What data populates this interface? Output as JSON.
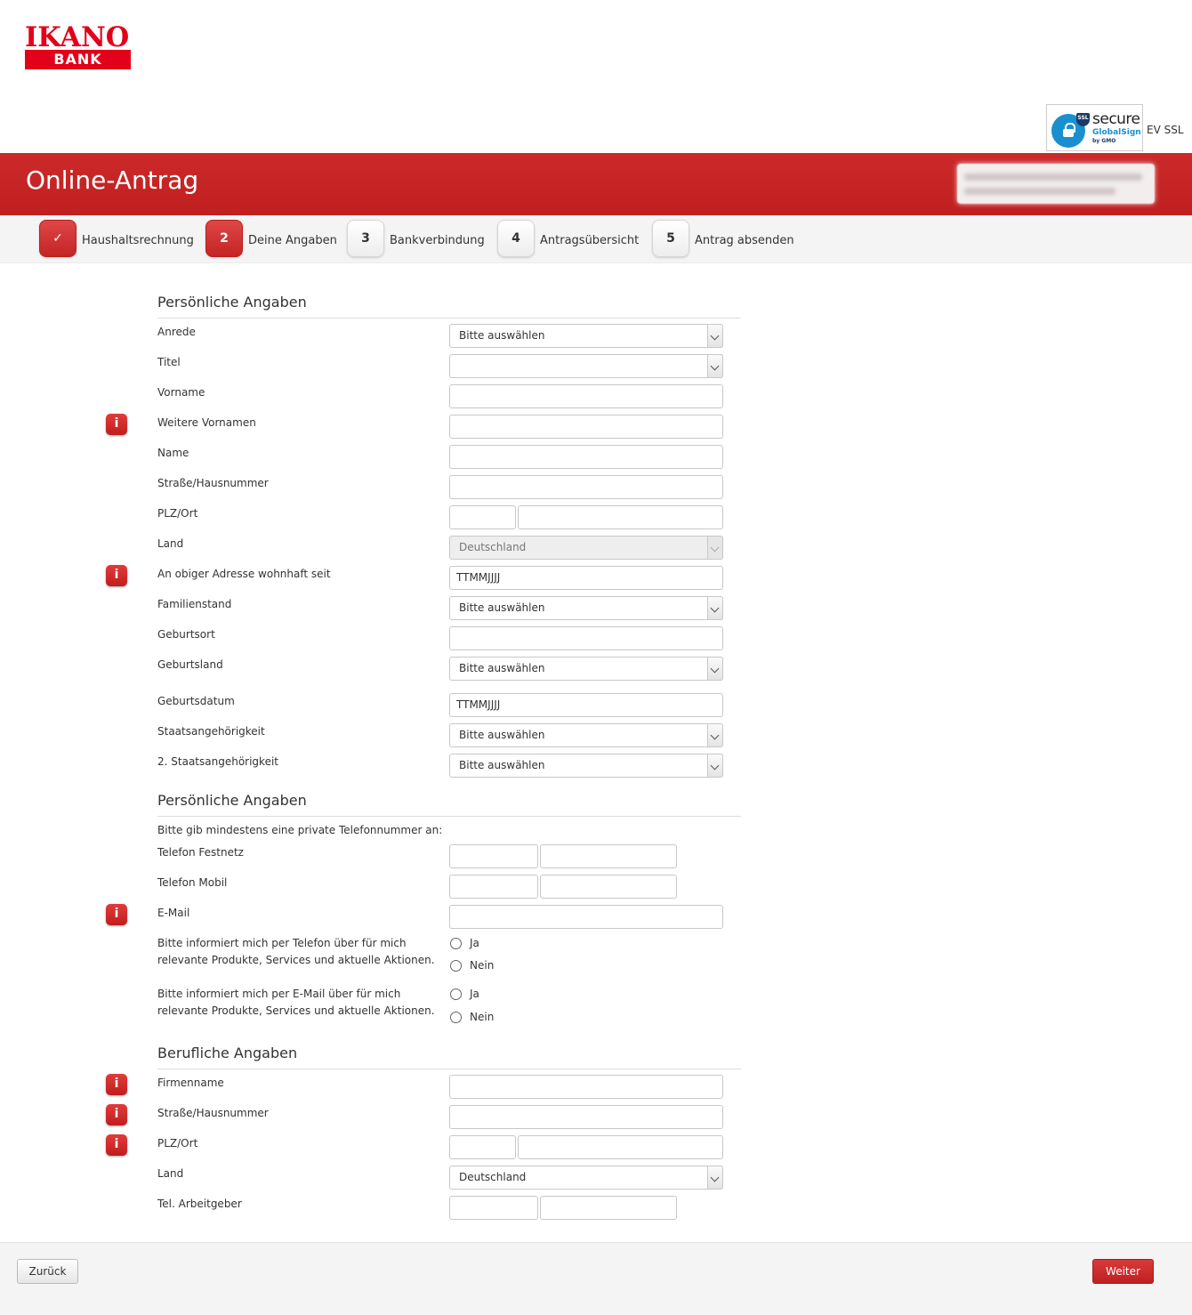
{
  "brand": {
    "logo_top": "IKANO",
    "logo_bottom": "BANK"
  },
  "ssl": {
    "badge": "SSL",
    "secure": "secure",
    "globalsign": "GlobalSign",
    "gmo": "by GMO",
    "ev": "EV SSL"
  },
  "header": {
    "title": "Online-Antrag"
  },
  "steps": [
    {
      "num": "✓",
      "label": "Haushaltsrechnung"
    },
    {
      "num": "2",
      "label": "Deine Angaben"
    },
    {
      "num": "3",
      "label": "Bankverbindung"
    },
    {
      "num": "4",
      "label": "Antragsübersicht"
    },
    {
      "num": "5",
      "label": "Antrag absenden"
    }
  ],
  "personal": {
    "title": "Persönliche Angaben",
    "anrede": {
      "label": "Anrede",
      "value": "Bitte auswählen"
    },
    "titel": {
      "label": "Titel",
      "value": ""
    },
    "vorname": {
      "label": "Vorname"
    },
    "weitere_vornamen": {
      "label": "Weitere Vornamen"
    },
    "name": {
      "label": "Name"
    },
    "strasse": {
      "label": "Straße/Hausnummer"
    },
    "plz_ort": {
      "label": "PLZ/Ort"
    },
    "land": {
      "label": "Land",
      "value": "Deutschland"
    },
    "wohnhaft_seit": {
      "label": "An obiger Adresse wohnhaft seit",
      "placeholder": "TTMMJJJJ"
    },
    "familienstand": {
      "label": "Familienstand",
      "value": "Bitte auswählen"
    },
    "geburtsort": {
      "label": "Geburtsort"
    },
    "geburtsland": {
      "label": "Geburtsland",
      "value": "Bitte auswählen"
    },
    "geburtsdatum": {
      "label": "Geburtsdatum",
      "placeholder": "TTMMJJJJ"
    },
    "staatsangehoerigkeit": {
      "label": "Staatsangehörigkeit",
      "value": "Bitte auswählen"
    },
    "staatsangehoerigkeit2": {
      "label": "2. Staatsangehörigkeit",
      "value": "Bitte auswählen"
    }
  },
  "contact": {
    "title": "Persönliche Angaben",
    "hint": "Bitte gib mindestens eine private Telefonnummer an:",
    "festnetz": {
      "label": "Telefon Festnetz"
    },
    "mobil": {
      "label": "Telefon Mobil"
    },
    "email": {
      "label": "E-Mail"
    },
    "phone_consent": {
      "line1": "Bitte informiert mich per Telefon über für mich",
      "line2": "relevante Produkte, Services und aktuelle Aktionen.",
      "yes": "Ja",
      "no": "Nein"
    },
    "email_consent": {
      "line1": "Bitte informiert mich per E-Mail über für mich",
      "line2": "relevante Produkte, Services und aktuelle Aktionen.",
      "yes": "Ja",
      "no": "Nein"
    }
  },
  "job": {
    "title": "Berufliche Angaben",
    "firmenname": {
      "label": "Firmenname"
    },
    "strasse": {
      "label": "Straße/Hausnummer"
    },
    "plz_ort": {
      "label": "PLZ/Ort"
    },
    "land": {
      "label": "Land",
      "value": "Deutschland"
    },
    "tel": {
      "label": "Tel. Arbeitgeber"
    }
  },
  "info_icon": "i",
  "footer": {
    "back": "Zurück",
    "next": "Weiter"
  },
  "colors": {
    "brand_red": "#c42424",
    "logo_red": "#e2001a"
  }
}
